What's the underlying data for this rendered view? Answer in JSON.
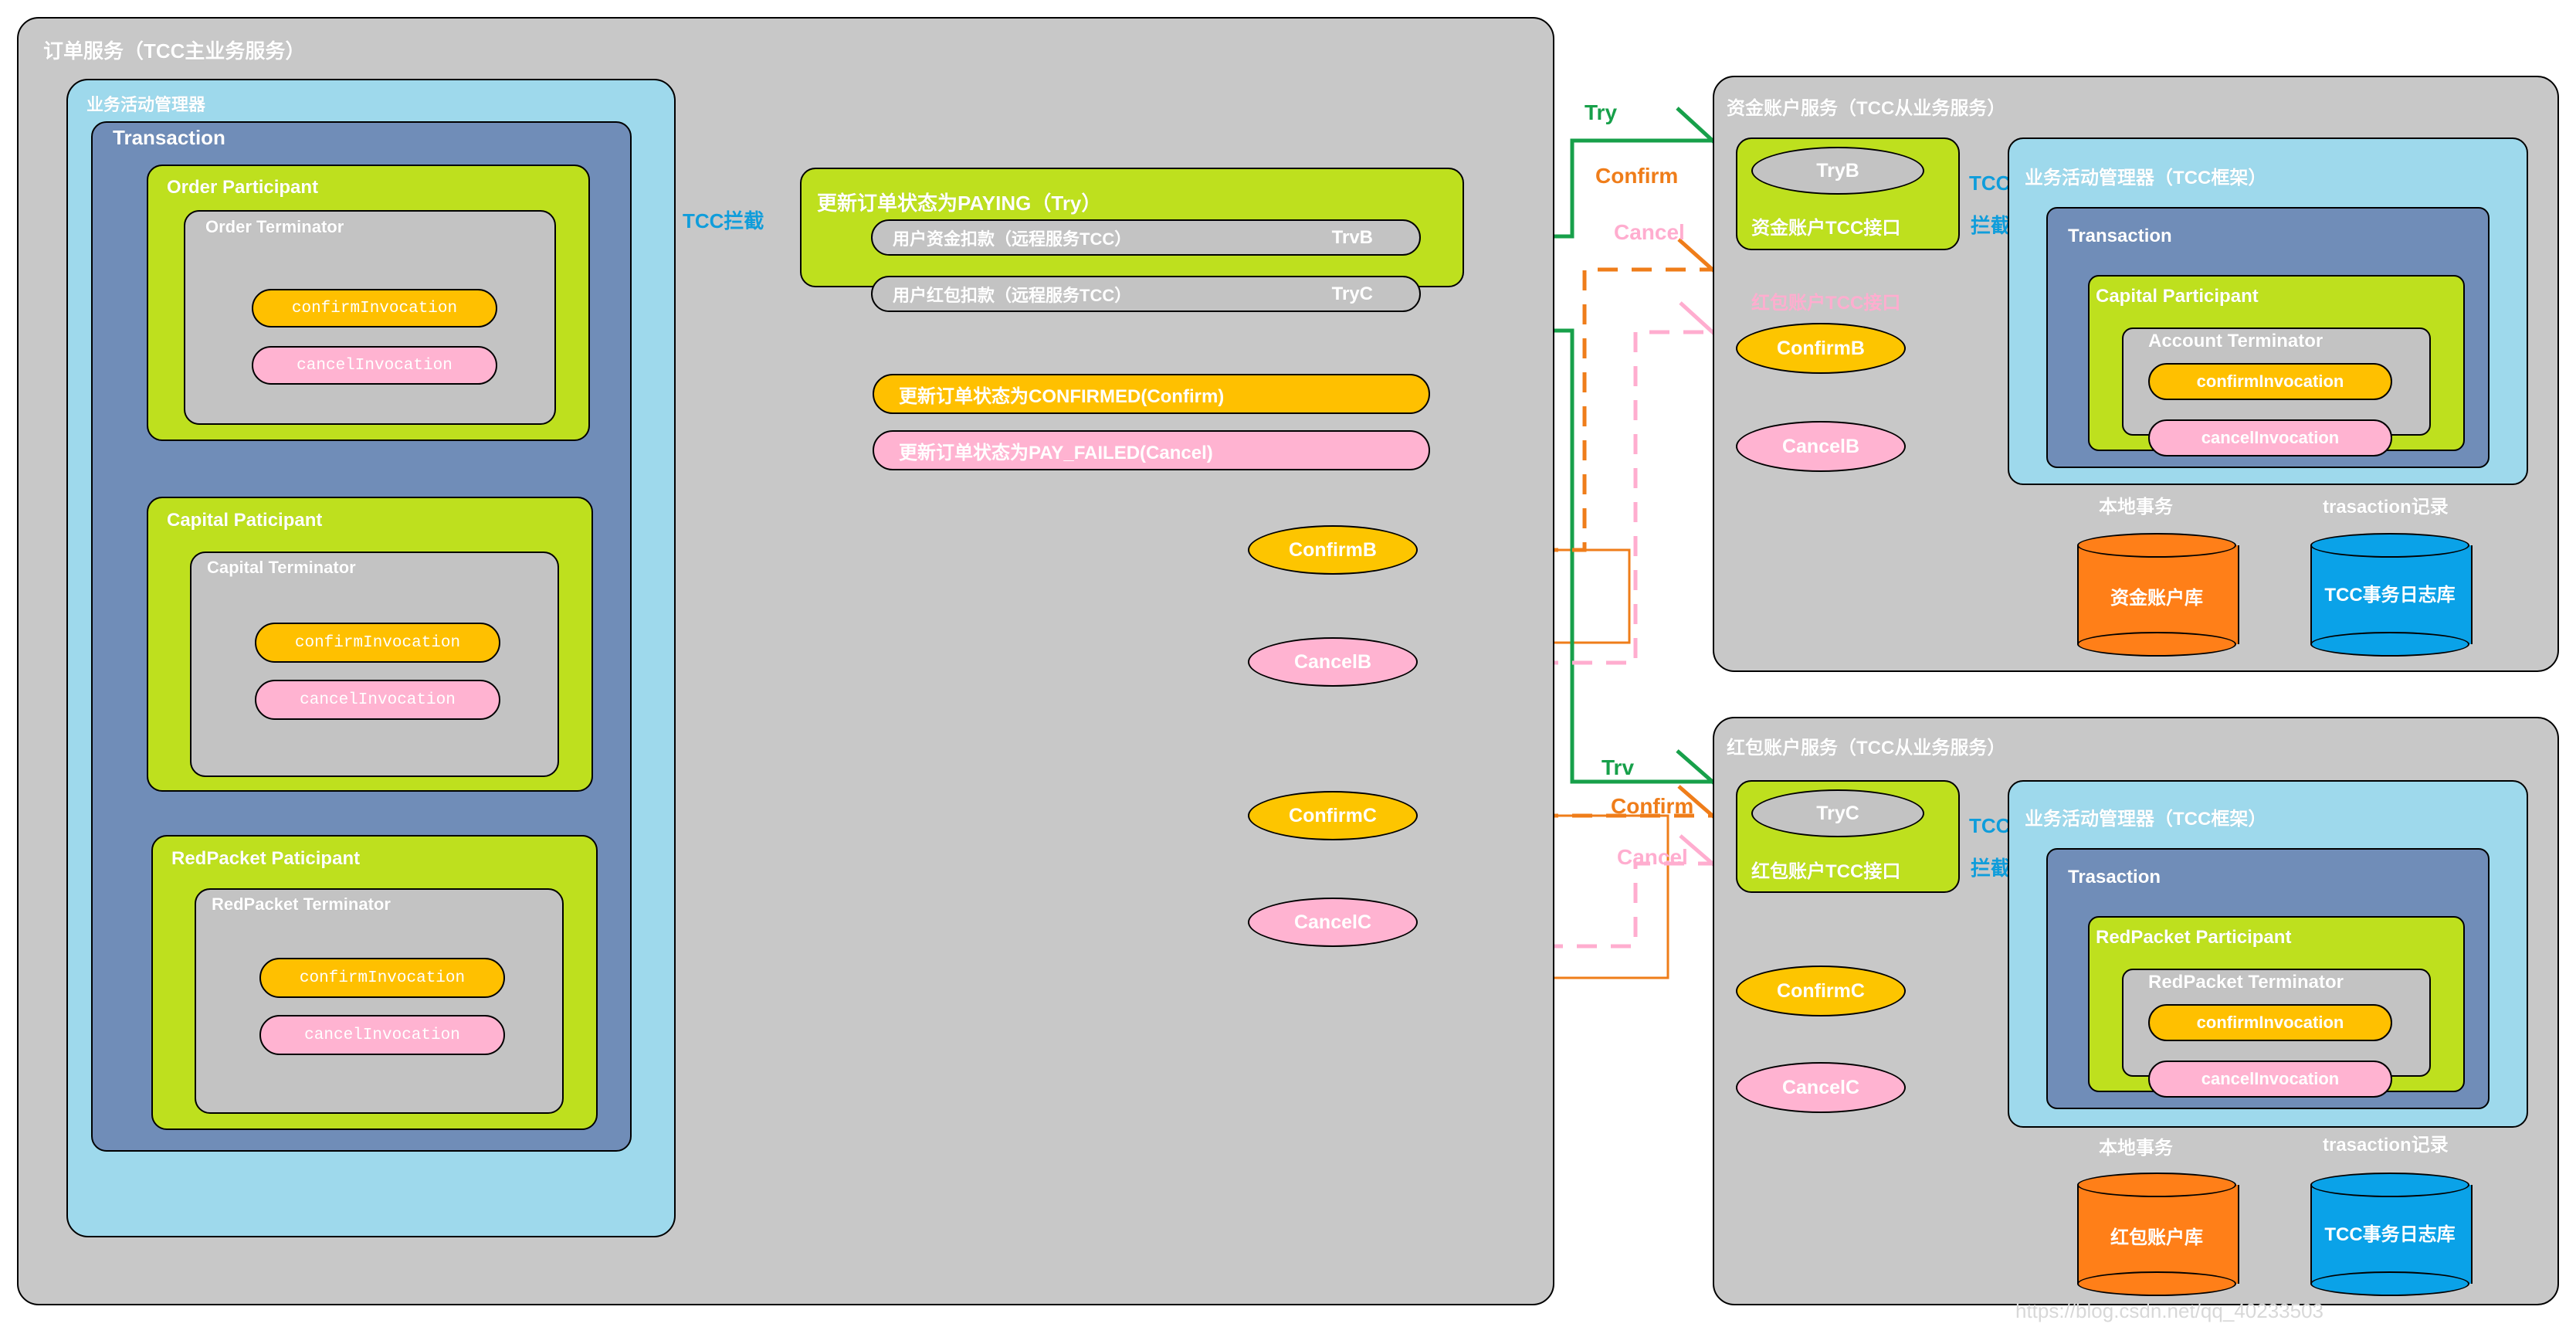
{
  "order_service": {
    "title": "订单服务（TCC主业务服务）",
    "bam_title": "业务活动管理器",
    "transaction_title": "Transaction",
    "participants": [
      {
        "title": "Order Participant",
        "terminator": "Order Terminator",
        "confirm": "confirmInvocation",
        "cancel": "cancelInvocation"
      },
      {
        "title": "Capital Paticipant",
        "terminator": "Capital Terminator",
        "confirm": "confirmInvocation",
        "cancel": "cancelInvocation"
      },
      {
        "title": "RedPacket Paticipant",
        "terminator": "RedPacket Terminator",
        "confirm": "confirmInvocation",
        "cancel": "cancelInvocation"
      }
    ],
    "tcc_intercept_label": "TCC拦截",
    "try_box": {
      "title": "更新订单状态为PAYING（Try）",
      "rows": [
        {
          "text": "用户资金扣款（远程服务TCC）",
          "tag": "TrvB"
        },
        {
          "text": "用户红包扣款（远程服务TCC）",
          "tag": "TryC"
        }
      ]
    },
    "confirm_bar": "更新订单状态为CONFIRMED(Confirm)",
    "cancel_bar": "更新订单状态为PAY_FAILED(Cancel)",
    "callouts": [
      {
        "label": "ConfirmB",
        "kind": "confirm"
      },
      {
        "label": "CancelB",
        "kind": "cancel"
      },
      {
        "label": "ConfirmC",
        "kind": "confirm"
      },
      {
        "label": "CancelC",
        "kind": "cancel"
      }
    ]
  },
  "bridge_labels": {
    "top": {
      "try": "Try",
      "confirm": "Confirm",
      "cancel": "Cancel"
    },
    "bottom": {
      "try": "Trv",
      "confirm": "Confirm",
      "cancel": "Cancel"
    }
  },
  "capital_service": {
    "title": "资金账户服务（TCC从业务服务）",
    "tcc_iface_box": {
      "try_label": "TryB",
      "caption": "资金账户TCC接口"
    },
    "tcc_intercept": {
      "line1": "TCC",
      "line2": "拦截"
    },
    "stray_label": "红包账户TCC接口",
    "confirm_ellipse": "ConfirmB",
    "cancel_ellipse": "CancelB",
    "bam_title": "业务活动管理器（TCC框架）",
    "transaction_title": "Transaction",
    "participant_title": "Capital Participant",
    "terminator_title": "Account Terminator",
    "confirm_pill": "confirmInvocation",
    "cancel_pill": "cancelInvocation",
    "db_local_caption": "本地事务",
    "db_local_name": "资金账户库",
    "db_log_caption": "trasaction记录",
    "db_log_name": "TCC事务日志库"
  },
  "redpacket_service": {
    "title": "红包账户服务（TCC从业务服务）",
    "tcc_iface_box": {
      "try_label": "TryC",
      "caption": "红包账户TCC接口"
    },
    "tcc_intercept": {
      "line1": "TCC",
      "line2": "拦截"
    },
    "confirm_ellipse": "ConfirmC",
    "cancel_ellipse": "CancelC",
    "bam_title": "业务活动管理器（TCC框架）",
    "transaction_title": "Trasaction",
    "participant_title": "RedPacket Participant",
    "terminator_title": "RedPacket Terminator",
    "confirm_pill": "confirmInvocation",
    "cancel_pill": "cancelInvocation",
    "db_local_caption": "本地事务",
    "db_local_name": "红包账户库",
    "db_log_caption": "trasaction记录",
    "db_log_name": "TCC事务日志库"
  },
  "watermark": "https://blog.csdn.net/qq_40233503",
  "colors": {
    "panel_gray": "#c8c8c8",
    "light_blue": "#9ed9ec",
    "slate_blue": "#708db8",
    "lime_green": "#bee01e",
    "amber": "#ffc000",
    "pink": "#ffb3d1",
    "try_green": "#17a04a",
    "confirm_orange": "#ef7d1a",
    "cancel_pink": "#ffadcf",
    "intercept_blue": "#0f9ddb",
    "db_orange": "#ff7f18",
    "db_blue": "#0aa2e8"
  }
}
